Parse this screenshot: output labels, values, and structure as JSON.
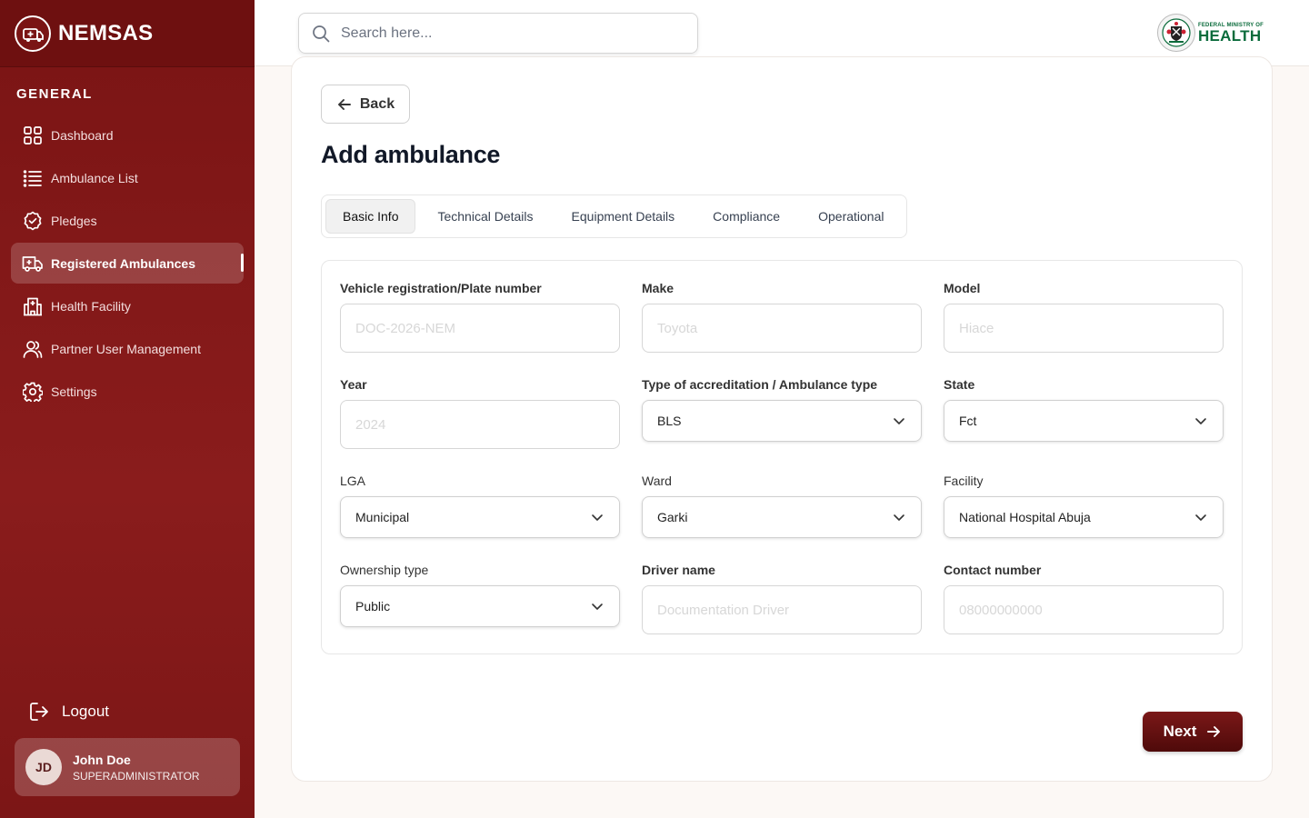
{
  "brand": {
    "name": "NEMSAS"
  },
  "sidebar": {
    "section_label": "GENERAL",
    "items": [
      {
        "label": "Dashboard",
        "icon": "grid-icon"
      },
      {
        "label": "Ambulance List",
        "icon": "list-icon"
      },
      {
        "label": "Pledges",
        "icon": "badge-check-icon"
      },
      {
        "label": "Registered Ambulances",
        "icon": "ambulance-icon",
        "active": true
      },
      {
        "label": "Health Facility",
        "icon": "hospital-icon"
      },
      {
        "label": "Partner User Management",
        "icon": "users-icon"
      },
      {
        "label": "Settings",
        "icon": "gear-icon"
      }
    ],
    "logout_label": "Logout",
    "user": {
      "initials": "JD",
      "name": "John Doe",
      "role": "SUPERADMINISTRATOR"
    }
  },
  "topbar": {
    "search_placeholder": "Search here...",
    "ministry_small": "FEDERAL MINISTRY OF",
    "ministry_big": "HEALTH"
  },
  "main": {
    "back_label": "Back",
    "title": "Add ambulance",
    "tabs": [
      "Basic Info",
      "Technical Details",
      "Equipment Details",
      "Compliance",
      "Operational"
    ],
    "active_tab": "Basic Info",
    "fields": {
      "plate": {
        "label": "Vehicle registration/Plate number",
        "placeholder": "DOC-2026-NEM"
      },
      "make": {
        "label": "Make",
        "placeholder": "Toyota"
      },
      "model": {
        "label": "Model",
        "placeholder": "Hiace"
      },
      "year": {
        "label": "Year",
        "placeholder": "2024"
      },
      "type": {
        "label": "Type of accreditation / Ambulance type",
        "value": "BLS"
      },
      "state": {
        "label": "State",
        "value": "Fct"
      },
      "lga": {
        "label": "LGA",
        "value": "Municipal"
      },
      "ward": {
        "label": "Ward",
        "value": "Garki"
      },
      "facility": {
        "label": "Facility",
        "value": "National Hospital Abuja"
      },
      "ownership": {
        "label": "Ownership type",
        "value": "Public"
      },
      "driver": {
        "label": "Driver name",
        "placeholder": "Documentation Driver"
      },
      "contact": {
        "label": "Contact number",
        "placeholder": "08000000000"
      }
    },
    "next_label": "Next"
  },
  "colors": {
    "sidebar": "#7a1414",
    "accent": "#5e0f0f",
    "ministry_green": "#0a6b3b"
  }
}
